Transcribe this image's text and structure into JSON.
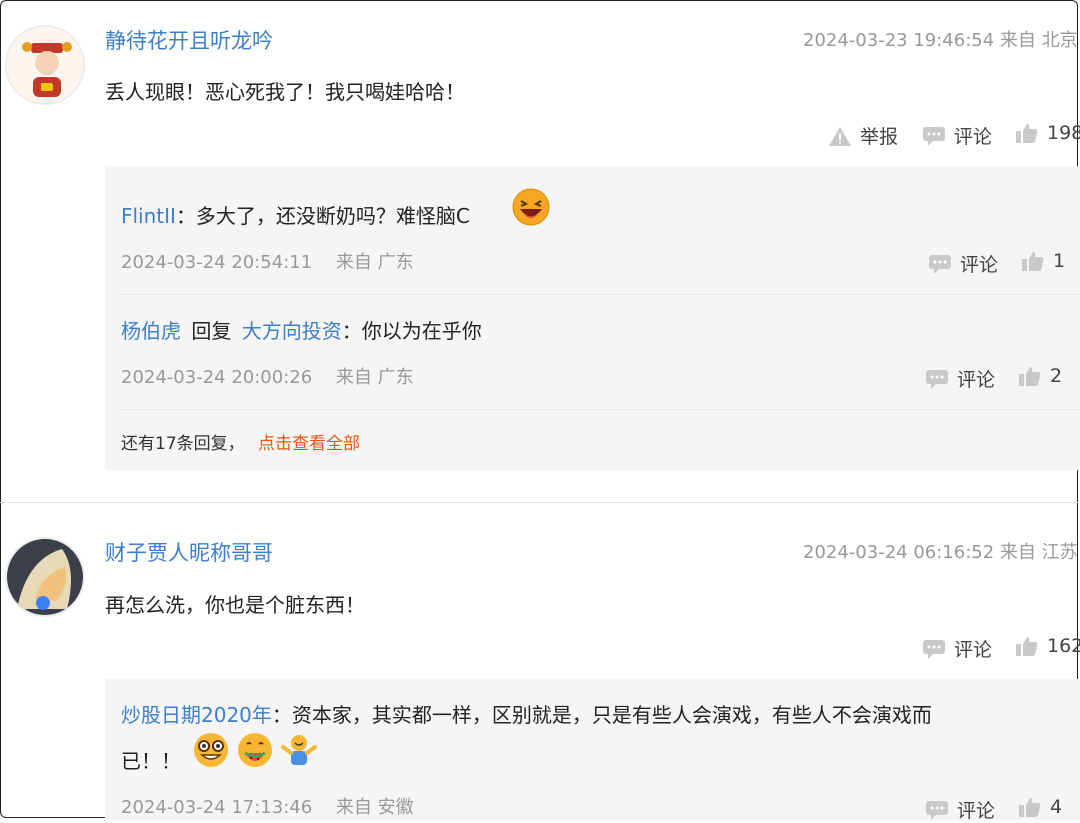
{
  "comments": [
    {
      "username": "静待花开且听龙吟",
      "time": "2024-03-23 19:46:54",
      "location": "来自 北京",
      "text": "丢人现眼！恶心死我了！我只喝娃哈哈！",
      "report_label": "举报",
      "comment_label": "评论",
      "likes": "198",
      "replies": [
        {
          "user": "FlintII",
          "text": "：多大了，还没断奶吗？难怪脑C",
          "time": "2024-03-24 20:54:11",
          "location": "来自 广东",
          "comment_label": "评论",
          "likes": "1"
        },
        {
          "user": "杨伯虎",
          "reply_word": "回复",
          "reply_to": "大方向投资",
          "text": "：你以为在乎你",
          "time": "2024-03-24 20:00:26",
          "location": "来自 广东",
          "comment_label": "评论",
          "likes": "2"
        }
      ],
      "more_prefix": "还有17条回复，",
      "more_link": "点击查看全部"
    },
    {
      "username": "财子贾人昵称哥哥",
      "time": "2024-03-24 06:16:52",
      "location": "来自 江苏",
      "text": "再怎么洗，你也是个脏东西！",
      "comment_label": "评论",
      "likes": "162",
      "replies": [
        {
          "user": "炒股日期2020年",
          "text": "：资本家，其实都一样，区别就是，只是有些人会演戏，有些人不会演戏而",
          "text2": "已！！",
          "time": "2024-03-24 17:13:46",
          "location": "来自 安徽",
          "comment_label": "评论",
          "likes": "4"
        }
      ]
    }
  ],
  "colors": {
    "link": "#3d7fc8",
    "accent": "#e8540f",
    "reply_bg": "#f5f5f5"
  }
}
